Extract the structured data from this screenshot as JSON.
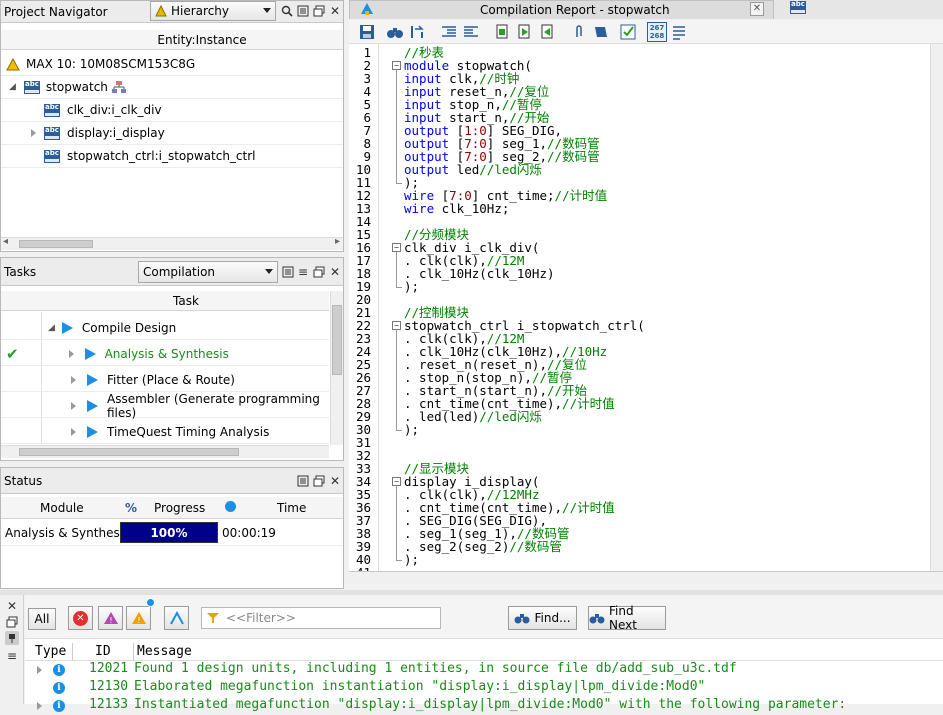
{
  "project_navigator": {
    "title": "Project Navigator",
    "view_select": "Hierarchy",
    "column_header": "Entity:Instance",
    "device": "MAX 10: 10M08SCM153C8G",
    "top_entity": "stopwatch",
    "children": [
      "clk_div:i_clk_div",
      "display:i_display",
      "stopwatch_ctrl:i_stopwatch_ctrl"
    ]
  },
  "tasks": {
    "title": "Tasks",
    "flow_select": "Compilation",
    "column_header": "Task",
    "items": [
      "Compile Design",
      "Analysis & Synthesis",
      "Fitter (Place & Route)",
      "Assembler (Generate programming files)",
      "TimeQuest Timing Analysis"
    ]
  },
  "status": {
    "title": "Status",
    "headers": {
      "module": "Module",
      "progress": "Progress",
      "time": "Time"
    },
    "row": {
      "module": "Analysis & Synthesis",
      "progress": "100%",
      "time": "00:00:19"
    },
    "progress_fraction": 1.0
  },
  "tabs": {
    "report": "Compilation Report - stopwatch",
    "close": "x"
  },
  "code_lines": [
    [
      [
        "cm",
        "//秒表"
      ]
    ],
    [
      [
        "kw",
        "module"
      ],
      [
        "",
        " stopwatch("
      ]
    ],
    [
      [
        "kw",
        "input"
      ],
      [
        "",
        " clk,"
      ],
      [
        "cm",
        "//时钟"
      ]
    ],
    [
      [
        "kw",
        "input"
      ],
      [
        "",
        " reset_n,"
      ],
      [
        "cm",
        "//复位"
      ]
    ],
    [
      [
        "kw",
        "input"
      ],
      [
        "",
        " stop_n,"
      ],
      [
        "cm",
        "//暂停"
      ]
    ],
    [
      [
        "kw",
        "input"
      ],
      [
        "",
        " start_n,"
      ],
      [
        "cm",
        "//开始"
      ]
    ],
    [
      [
        "kw",
        "output"
      ],
      [
        "",
        " ["
      ],
      [
        "num",
        "1:0"
      ],
      [
        "",
        "] SEG_DIG,"
      ]
    ],
    [
      [
        "kw",
        "output"
      ],
      [
        "",
        " ["
      ],
      [
        "num",
        "7:0"
      ],
      [
        "",
        "] seg_1,"
      ],
      [
        "cm",
        "//数码管"
      ]
    ],
    [
      [
        "kw",
        "output"
      ],
      [
        "",
        " ["
      ],
      [
        "num",
        "7:0"
      ],
      [
        "",
        "] seg_2,"
      ],
      [
        "cm",
        "//数码管"
      ]
    ],
    [
      [
        "kw",
        "output"
      ],
      [
        "",
        " led"
      ],
      [
        "cm",
        "//led闪烁"
      ]
    ],
    [
      [
        "",
        ");"
      ]
    ],
    [
      [
        "kw",
        "wire"
      ],
      [
        "",
        " ["
      ],
      [
        "num",
        "7:0"
      ],
      [
        "",
        "] cnt_time;"
      ],
      [
        "cm",
        "//计时值"
      ]
    ],
    [
      [
        "kw",
        "wire"
      ],
      [
        "",
        " clk_10Hz;"
      ]
    ],
    [
      [
        "",
        ""
      ]
    ],
    [
      [
        "cm",
        "//分频模块"
      ]
    ],
    [
      [
        "",
        "clk_div i_clk_div("
      ]
    ],
    [
      [
        "",
        ". clk(clk),"
      ],
      [
        "cm",
        "//12M"
      ]
    ],
    [
      [
        "",
        ". clk_10Hz(clk_10Hz)"
      ]
    ],
    [
      [
        "",
        ");"
      ]
    ],
    [
      [
        "",
        ""
      ]
    ],
    [
      [
        "cm",
        "//控制模块"
      ]
    ],
    [
      [
        "",
        "stopwatch_ctrl i_stopwatch_ctrl("
      ]
    ],
    [
      [
        "",
        ". clk(clk),"
      ],
      [
        "cm",
        "//12M"
      ]
    ],
    [
      [
        "",
        ". clk_10Hz(clk_10Hz),"
      ],
      [
        "cm",
        "//10Hz"
      ]
    ],
    [
      [
        "",
        ". reset_n(reset_n),"
      ],
      [
        "cm",
        "//复位"
      ]
    ],
    [
      [
        "",
        ". stop_n(stop_n),"
      ],
      [
        "cm",
        "//暂停"
      ]
    ],
    [
      [
        "",
        ". start_n(start_n),"
      ],
      [
        "cm",
        "//开始"
      ]
    ],
    [
      [
        "",
        ". cnt_time(cnt_time),"
      ],
      [
        "cm",
        "//计时值"
      ]
    ],
    [
      [
        "",
        ". led(led)"
      ],
      [
        "cm",
        "//led闪烁"
      ]
    ],
    [
      [
        "",
        ");"
      ]
    ],
    [
      [
        "",
        ""
      ]
    ],
    [
      [
        "",
        ""
      ]
    ],
    [
      [
        "cm",
        "//显示模块"
      ]
    ],
    [
      [
        "",
        "display i_display("
      ]
    ],
    [
      [
        "",
        ". clk(clk),"
      ],
      [
        "cm",
        "//12MHz"
      ]
    ],
    [
      [
        "",
        ". cnt_time(cnt_time),"
      ],
      [
        "cm",
        "//计时值"
      ]
    ],
    [
      [
        "",
        ". SEG_DIG(SEG_DIG),"
      ]
    ],
    [
      [
        "",
        ". seg_1(seg_1),"
      ],
      [
        "cm",
        "//数码管"
      ]
    ],
    [
      [
        "",
        ". seg_2(seg_2)"
      ],
      [
        "cm",
        "//数码管"
      ]
    ],
    [
      [
        "",
        ");"
      ]
    ],
    [
      [
        "",
        ""
      ]
    ]
  ],
  "messages": {
    "all_label": "All",
    "filter_placeholder": "<<Filter>>",
    "find_label": "Find...",
    "find_next_label": "Find Next",
    "headers": {
      "type": "Type",
      "id": "ID",
      "message": "Message"
    },
    "rows": [
      {
        "id": "12021",
        "text": "Found 1 design units, including 1 entities, in source file db/add_sub_u3c.tdf"
      },
      {
        "id": "12130",
        "text": "Elaborated megafunction instantiation \"display:i_display|lpm_divide:Mod0\""
      },
      {
        "id": "12133",
        "text": "Instantiated megafunction \"display:i_display|lpm_divide:Mod0\" with the following parameter:"
      }
    ]
  },
  "colors": {
    "progress_fill": "#00008b",
    "accent": "#1a8fe3",
    "keyword": "#0000ff",
    "comment": "#008000"
  }
}
